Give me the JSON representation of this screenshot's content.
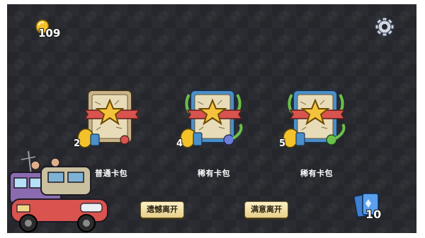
{
  "hud": {
    "coins": "109",
    "cards": "10"
  },
  "packs": [
    {
      "name": "普通卡包",
      "price": "2",
      "frame": "plain",
      "accent": "#c9b48a"
    },
    {
      "name": "稀有卡包",
      "price": "4",
      "frame": "rare",
      "accent": "#4a8fc9"
    },
    {
      "name": "稀有卡包",
      "price": "5",
      "frame": "rare",
      "accent": "#4a8fc9"
    }
  ],
  "buttons": {
    "leave_regret": "遗憾离开",
    "leave_satisfied": "满意离开"
  },
  "icons": {
    "coin": "gold-coin-icon",
    "settings": "gear-icon",
    "cards": "card-stack-icon"
  },
  "colors": {
    "background": "#25272c",
    "button": "#f5e6b0",
    "ribbon": "#d9534f",
    "star": "#f5c33b"
  }
}
